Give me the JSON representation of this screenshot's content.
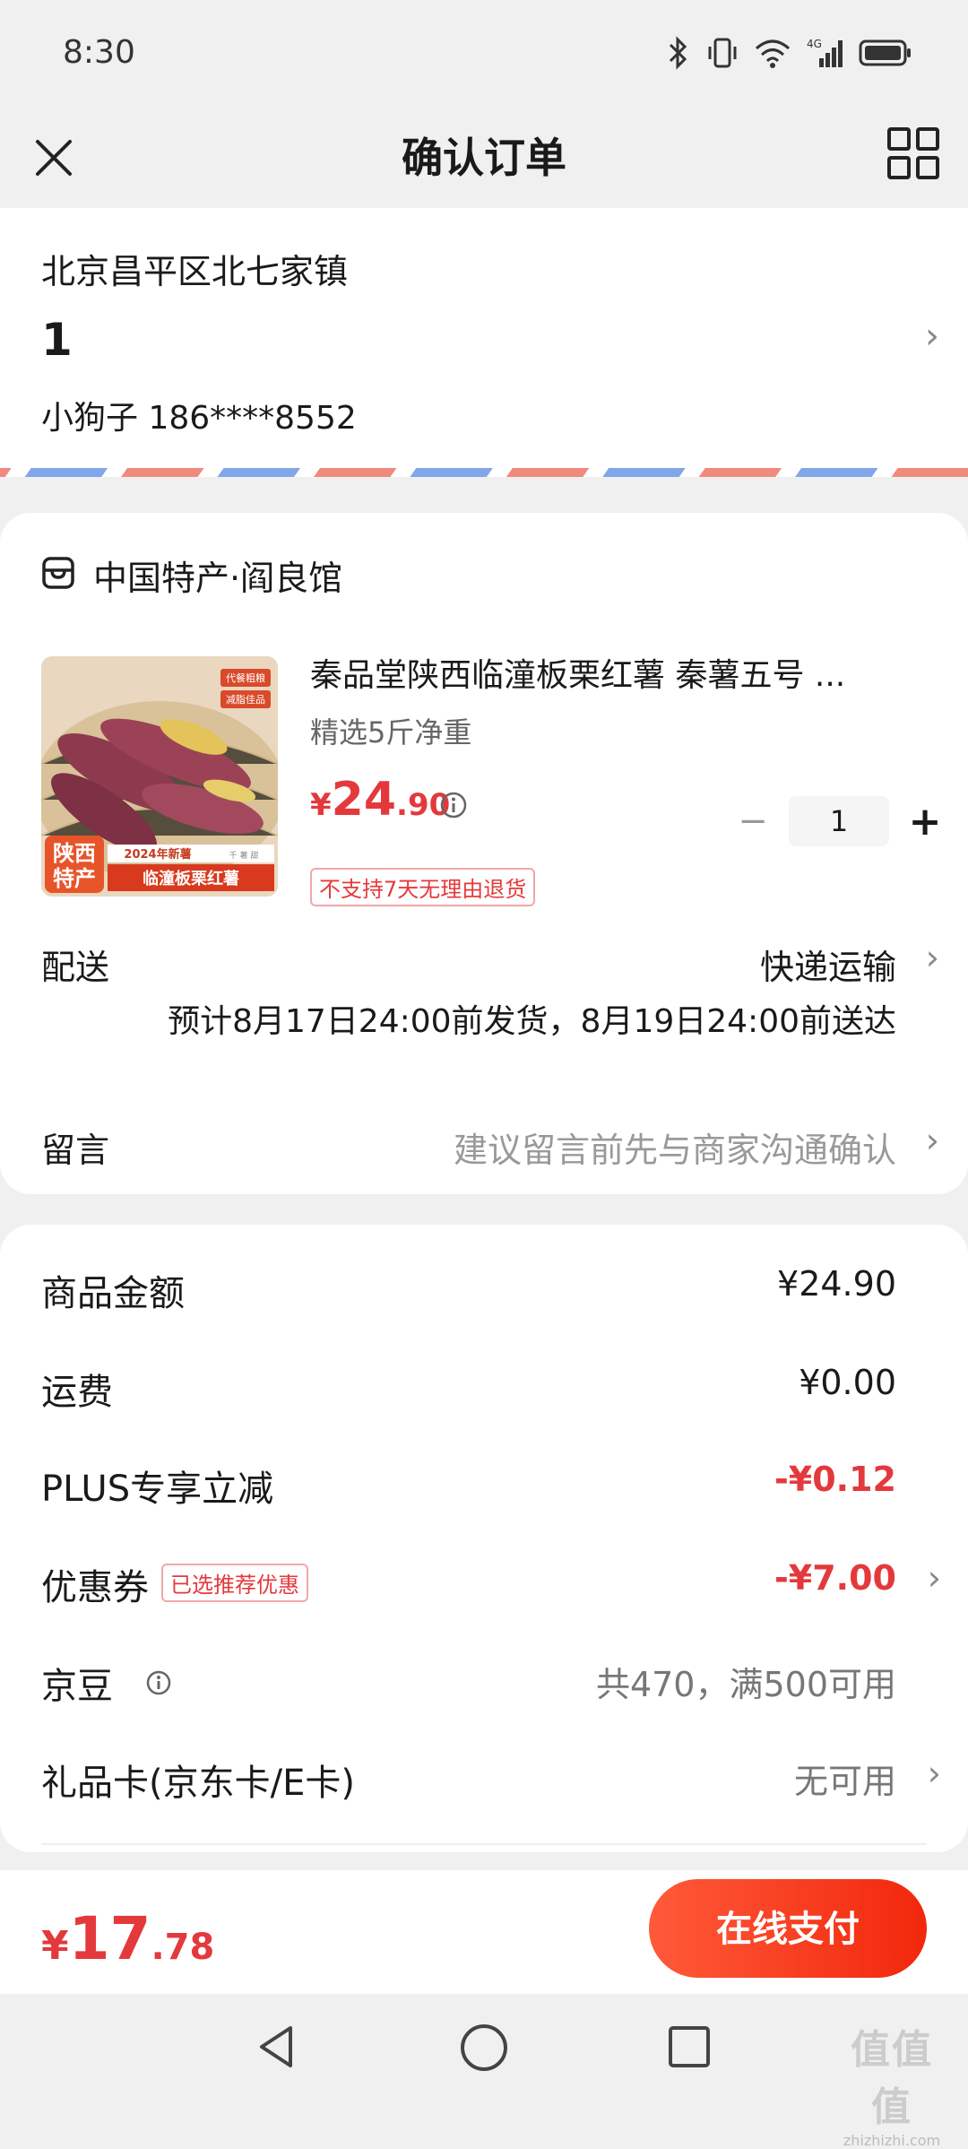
{
  "status_bar": {
    "time": "8:30",
    "network": "4G"
  },
  "nav": {
    "title": "确认订单"
  },
  "address": {
    "region": "北京昌平区北七家镇",
    "detail": "1",
    "contact": "小狗子 186****8552"
  },
  "shop": {
    "name": "中国特产·阎良馆",
    "product": {
      "title": "秦品堂陕西临潼板栗红薯 秦薯五号 ...",
      "spec": "精选5斤净重",
      "price_currency": "¥",
      "price_int": "24",
      "price_dec": ".90",
      "quantity": "1",
      "minus": "−",
      "plus": "+",
      "badge": "不支持7天无理由退货",
      "image_texts": {
        "tag1": "代餐粗粮",
        "tag2": "减脂佳品",
        "region1": "陕西",
        "region2": "特产",
        "year": "2024年新薯",
        "name": "临潼板栗红薯",
        "grade": "千 薯 甜"
      }
    },
    "shipping": {
      "label": "配送",
      "method": "快递运输",
      "eta": "预计8月17日24:00前发货，8月19日24:00前送达"
    },
    "message": {
      "label": "留言",
      "placeholder": "建议留言前先与商家沟通确认"
    }
  },
  "summary": {
    "goods_amount": {
      "label": "商品金额",
      "value": "¥24.90"
    },
    "freight": {
      "label": "运费",
      "value": "¥0.00"
    },
    "plus_discount": {
      "label": "PLUS专享立减",
      "value": "-¥0.12"
    },
    "coupon": {
      "label": "优惠券",
      "tag": "已选推荐优惠",
      "value": "-¥7.00"
    },
    "jingdou": {
      "label": "京豆",
      "value": "共470，满500可用"
    },
    "giftcard": {
      "label": "礼品卡(京东卡/E卡)",
      "value": "无可用"
    }
  },
  "paybar": {
    "currency": "¥",
    "total_int": "17",
    "total_dec": ".78",
    "pay_label": "在线支付"
  },
  "watermark": {
    "big": "值值值",
    "small": "zhizhizhi.com"
  },
  "colors": {
    "accent_red": "#e4393c",
    "pay_button": "#f2270c",
    "bg": "#f0f0f0"
  }
}
